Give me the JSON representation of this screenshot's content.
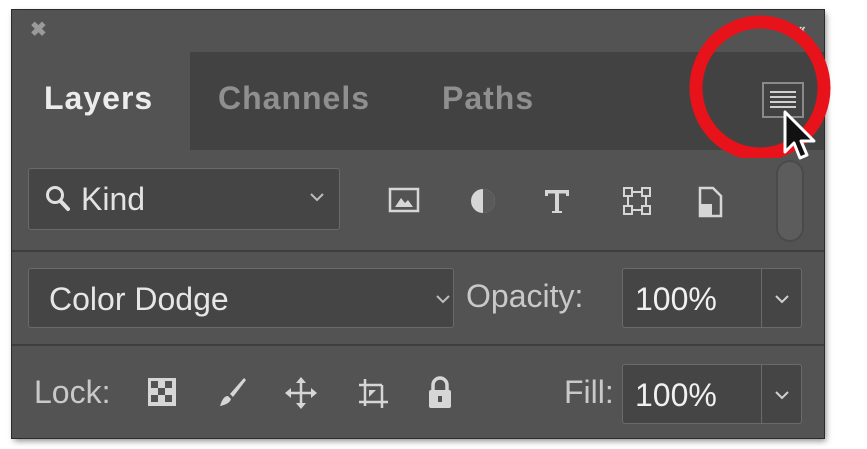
{
  "panel": {
    "tabs": [
      {
        "label": "Layers",
        "active": true
      },
      {
        "label": "Channels",
        "active": false
      },
      {
        "label": "Paths",
        "active": false
      }
    ],
    "filter": {
      "label": "Kind",
      "icons": [
        "image-filter-icon",
        "adjustment-filter-icon",
        "type-filter-icon",
        "shape-filter-icon",
        "smart-object-filter-icon"
      ]
    },
    "blend_mode": "Color Dodge",
    "opacity_label": "Opacity:",
    "opacity_value": "100%",
    "lock_label": "Lock:",
    "lock_icons": [
      "lock-transparent-pixels-icon",
      "lock-image-pixels-icon",
      "lock-position-icon",
      "lock-artboard-icon",
      "lock-all-icon"
    ],
    "fill_label": "Fill:",
    "fill_value": "100%"
  },
  "annotation": {
    "ring_color": "#e8121a"
  },
  "colors": {
    "panel_bg": "#535353",
    "tabbar_bg": "#424242",
    "field_bg": "#454545"
  }
}
